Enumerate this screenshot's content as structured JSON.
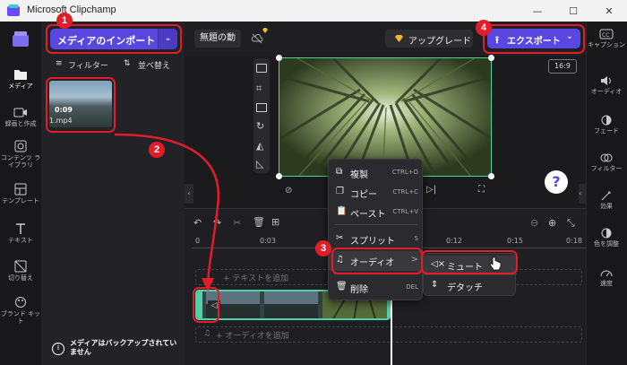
{
  "window": {
    "title": "Microsoft Clipchamp",
    "minimize": "—",
    "maximize": "☐",
    "close": "✕"
  },
  "left_rail": {
    "items": [
      {
        "label": "メディア",
        "icon": "folder-icon"
      },
      {
        "label": "録画と作成",
        "icon": "camera-icon"
      },
      {
        "label": "コンテンツ ライブラリ",
        "icon": "library-icon"
      },
      {
        "label": "テンプレート",
        "icon": "template-icon"
      },
      {
        "label": "テキスト",
        "icon": "text-icon"
      },
      {
        "label": "切り替え",
        "icon": "transition-icon"
      },
      {
        "label": "ブランド キット",
        "icon": "brand-kit-icon"
      }
    ]
  },
  "media_panel": {
    "import_label": "メディアのインポート",
    "filter_label": "フィルター",
    "sort_label": "並べ替え",
    "thumb_duration": "0:09",
    "thumb_name": "1.mp4",
    "backup_note": "メディアはバックアップされていません"
  },
  "topbar": {
    "project_name": "無題の動",
    "upgrade_label": "アップグレード",
    "export_label": "エクスポート",
    "aspect_ratio": "16:9"
  },
  "help": "?",
  "timeline": {
    "ticks": [
      "0",
      "0:03",
      "0:12",
      "0:15",
      "0:18"
    ],
    "text_track_label": "+ テキストを追加",
    "audio_track_label": "+ オーディオを追加"
  },
  "context_menu": {
    "items": [
      {
        "label": "複製",
        "shortcut": "CTRL+D"
      },
      {
        "label": "コピー",
        "shortcut": "CTRL+C"
      },
      {
        "label": "ペースト",
        "shortcut": "CTRL+V"
      },
      {
        "label": "スプリット",
        "shortcut": "S"
      },
      {
        "label": "オーディオ",
        "shortcut": ">"
      },
      {
        "label": "削除",
        "shortcut": "DEL"
      }
    ],
    "submenu": [
      {
        "label": "ミュート"
      },
      {
        "label": "デタッチ"
      }
    ]
  },
  "right_rail": {
    "items": [
      {
        "label": "キャプション",
        "icon": "captions-icon"
      },
      {
        "label": "オーディオ",
        "icon": "speaker-icon"
      },
      {
        "label": "フェード",
        "icon": "fade-icon"
      },
      {
        "label": "フィルター",
        "icon": "filter-icon"
      },
      {
        "label": "効果",
        "icon": "effects-icon"
      },
      {
        "label": "色を調整",
        "icon": "color-adjust-icon"
      },
      {
        "label": "速度",
        "icon": "speed-icon"
      }
    ]
  },
  "annotations": [
    "1",
    "2",
    "3",
    "4"
  ],
  "colors": {
    "accent": "#5a46e0",
    "highlight": "#e11d2a",
    "selection": "#4fd1a5"
  }
}
